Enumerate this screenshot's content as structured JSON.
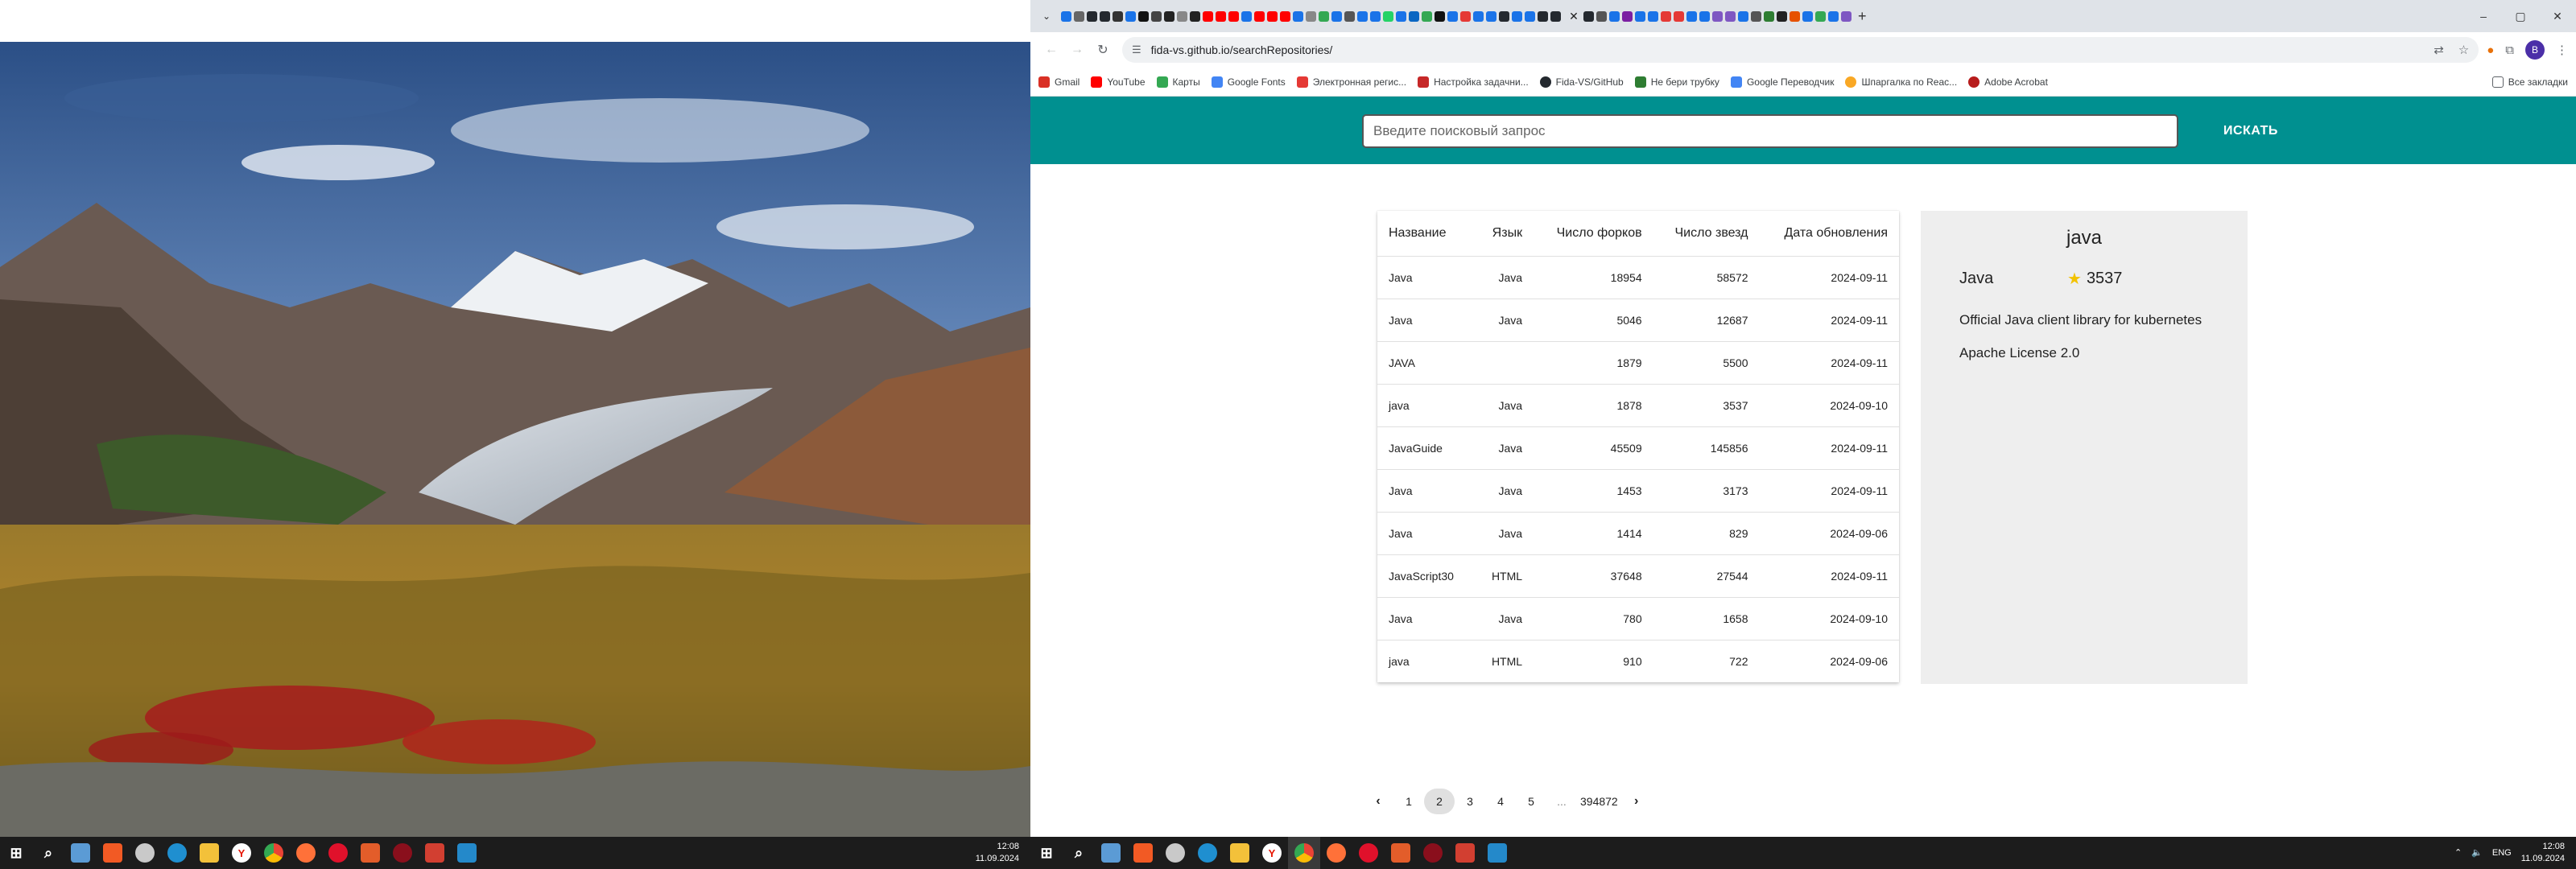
{
  "left_taskbar": {
    "clock_time": "12:08",
    "clock_date": "11.09.2024"
  },
  "browser": {
    "tabstrip": {
      "newtab_label": "+",
      "window_buttons": [
        "–",
        "▢",
        "✕"
      ]
    },
    "toolbar": {
      "url": "fida-vs.github.io/searchRepositories/",
      "profile_letter": "B"
    },
    "bookmarks": [
      {
        "label": "Gmail",
        "color": "#d93025"
      },
      {
        "label": "YouTube",
        "color": "#ff0000"
      },
      {
        "label": "Карты",
        "color": "#34a853"
      },
      {
        "label": "Google Fonts",
        "color": "#4285f4"
      },
      {
        "label": "Электронная регис...",
        "color": "#e53935"
      },
      {
        "label": "Настройка задачни...",
        "color": "#c62828"
      },
      {
        "label": "Fida-VS/GitHub",
        "color": "#24292f"
      },
      {
        "label": "Не бери трубку",
        "color": "#2e7d32"
      },
      {
        "label": "Google Переводчик",
        "color": "#4285f4"
      },
      {
        "label": "Шпаргалка по Reac...",
        "color": "#f9a825"
      },
      {
        "label": "Adobe Acrobat",
        "color": "#b71c1c"
      }
    ],
    "bookmarks_right": "Все закладки"
  },
  "search": {
    "placeholder": "Введите поисковый запрос",
    "button_label": "ИСКАТЬ"
  },
  "table": {
    "headers": [
      "Название",
      "Язык",
      "Число форков",
      "Число звезд",
      "Дата обновления"
    ],
    "rows": [
      {
        "name": "Java",
        "lang": "Java",
        "forks": "18954",
        "stars": "58572",
        "date": "2024-09-11"
      },
      {
        "name": "Java",
        "lang": "Java",
        "forks": "5046",
        "stars": "12687",
        "date": "2024-09-11"
      },
      {
        "name": "JAVA",
        "lang": "",
        "forks": "1879",
        "stars": "5500",
        "date": "2024-09-11"
      },
      {
        "name": "java",
        "lang": "Java",
        "forks": "1878",
        "stars": "3537",
        "date": "2024-09-10"
      },
      {
        "name": "JavaGuide",
        "lang": "Java",
        "forks": "45509",
        "stars": "145856",
        "date": "2024-09-11"
      },
      {
        "name": "Java",
        "lang": "Java",
        "forks": "1453",
        "stars": "3173",
        "date": "2024-09-11"
      },
      {
        "name": "Java",
        "lang": "Java",
        "forks": "1414",
        "stars": "829",
        "date": "2024-09-06"
      },
      {
        "name": "JavaScript30",
        "lang": "HTML",
        "forks": "37648",
        "stars": "27544",
        "date": "2024-09-11"
      },
      {
        "name": "Java",
        "lang": "Java",
        "forks": "780",
        "stars": "1658",
        "date": "2024-09-10"
      },
      {
        "name": "java",
        "lang": "HTML",
        "forks": "910",
        "stars": "722",
        "date": "2024-09-06"
      }
    ]
  },
  "detail": {
    "title": "java",
    "language": "Java",
    "stars": "3537",
    "description": "Official Java client library for kubernetes",
    "license": "Apache License 2.0"
  },
  "pagination": {
    "prev": "‹",
    "pages": [
      "1",
      "2",
      "3",
      "4",
      "5"
    ],
    "selected": "2",
    "ellipsis": "...",
    "last": "394872",
    "next": "›"
  },
  "right_taskbar": {
    "lang": "ENG",
    "clock_time": "12:08",
    "clock_date": "11.09.2024"
  }
}
